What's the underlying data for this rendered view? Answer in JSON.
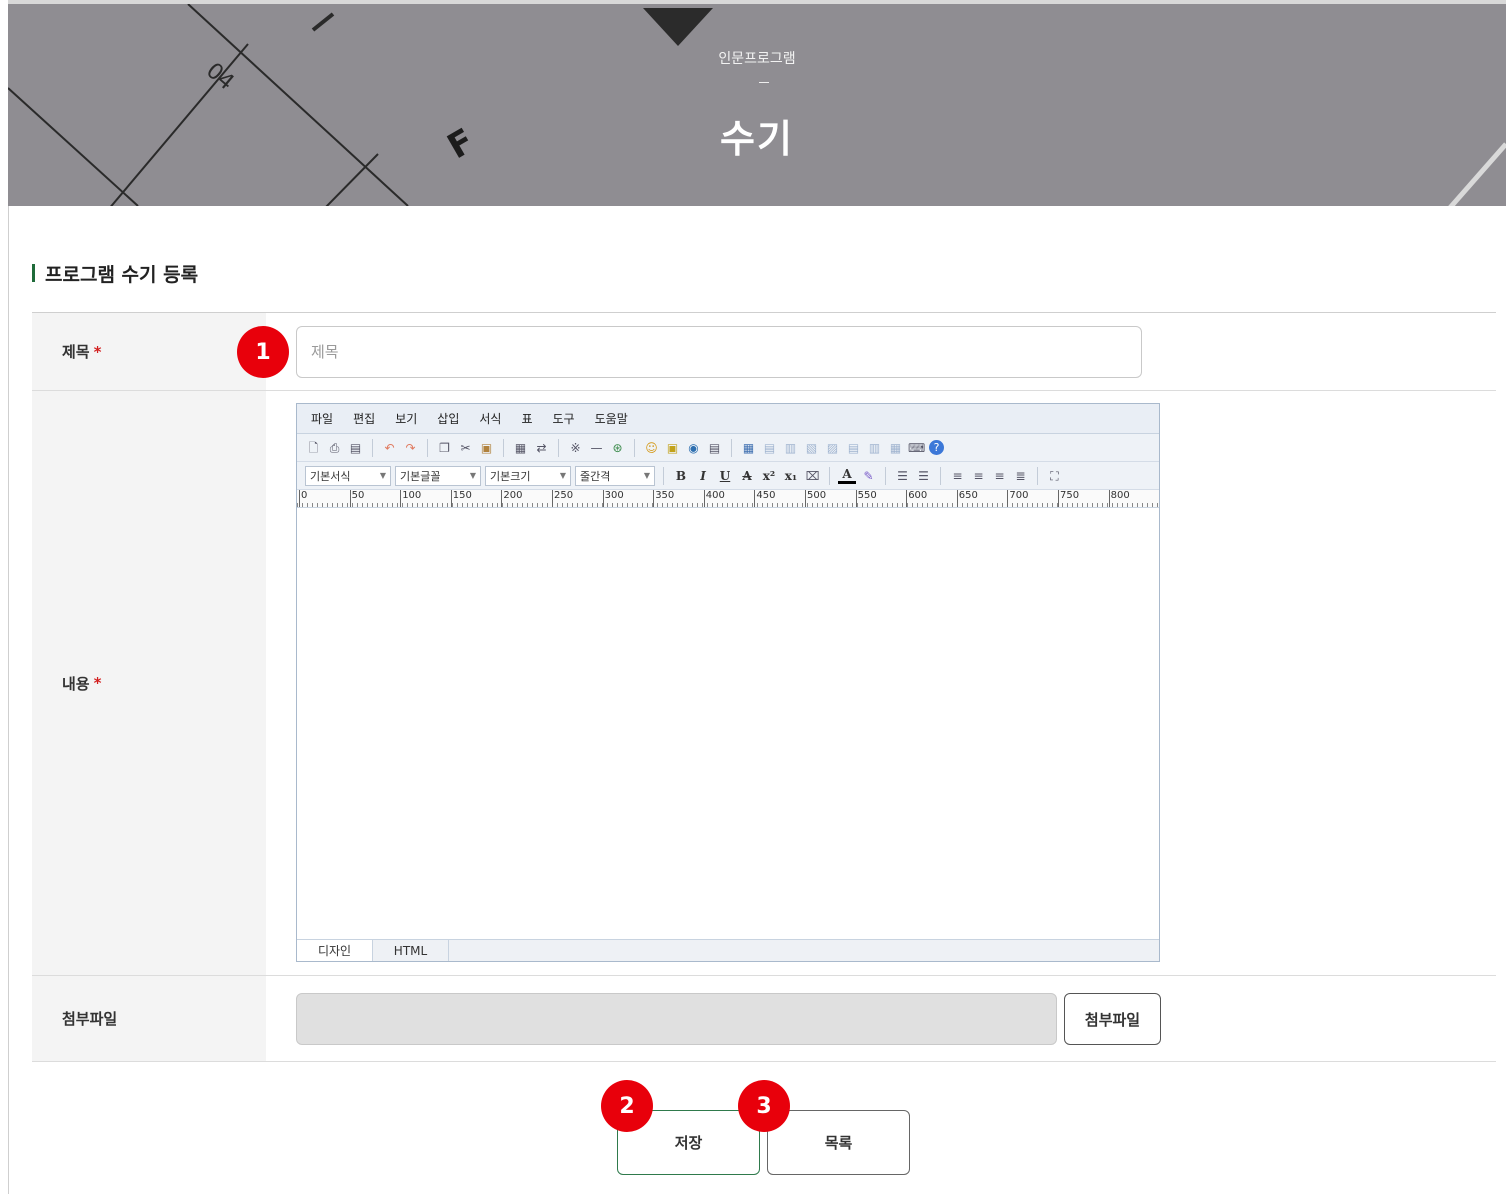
{
  "banner": {
    "breadcrumb": "인문프로그램",
    "title": "수기"
  },
  "section": {
    "title": "프로그램 수기 등록"
  },
  "form": {
    "title_label": "제목",
    "title_placeholder": "제목",
    "content_label": "내용",
    "attachment_label": "첨부파일",
    "attachment_button": "첨부파일",
    "required_mark": "*"
  },
  "editor": {
    "menu": [
      "파일",
      "편집",
      "보기",
      "삽입",
      "서식",
      "표",
      "도구",
      "도움말"
    ],
    "selects": {
      "format": "기본서식",
      "font": "기본글꼴",
      "size": "기본크기",
      "line_spacing": "줄간격"
    },
    "ruler": [
      "0",
      "50",
      "100",
      "150",
      "200",
      "250",
      "300",
      "350",
      "400",
      "450",
      "500",
      "550",
      "600",
      "650",
      "700",
      "750",
      "800"
    ],
    "tabs": [
      "디자인",
      "HTML"
    ]
  },
  "actions": {
    "save": "저장",
    "list": "목록"
  },
  "callouts": [
    "1",
    "2",
    "3"
  ],
  "colors": {
    "accent_green": "#1f6b3a",
    "badge_red": "#e8000b"
  }
}
